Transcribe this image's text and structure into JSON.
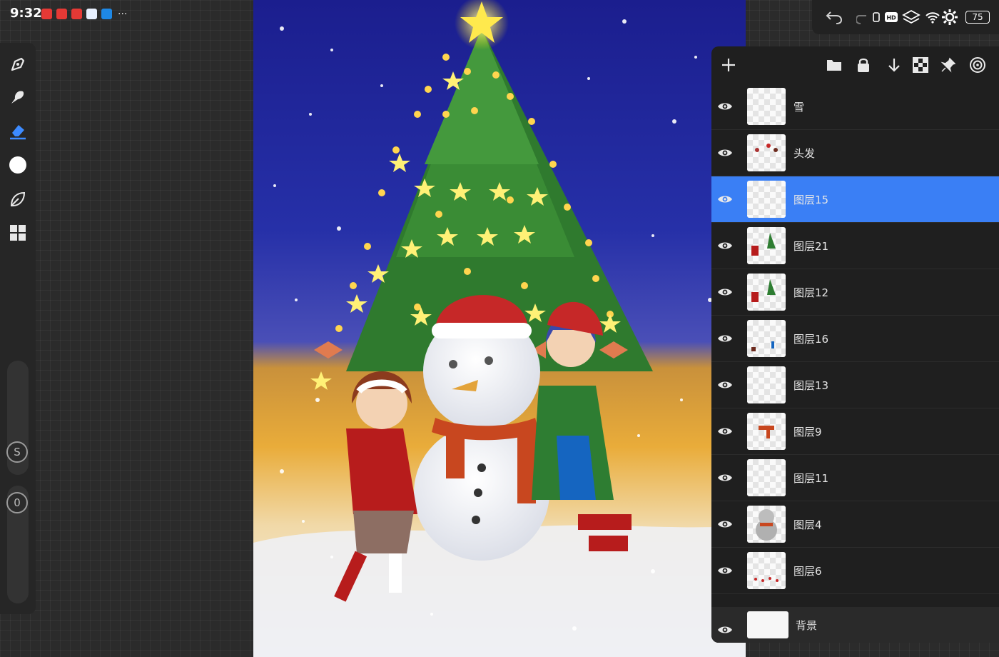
{
  "status_bar": {
    "time": "9:32",
    "more": "···"
  },
  "app_icons": [
    {
      "name": "app-red-1",
      "color": "#e53935"
    },
    {
      "name": "app-red-2",
      "color": "#e53935"
    },
    {
      "name": "app-red-3",
      "color": "#e53935"
    },
    {
      "name": "app-white",
      "color": "#e8f0fe"
    },
    {
      "name": "app-blue",
      "color": "#1e88e5"
    }
  ],
  "system_status": {
    "battery": "75"
  },
  "left_toolbar": {
    "tools": [
      "brush-icon",
      "smudge-icon",
      "eraser-icon",
      "color-icon",
      "leaf-icon",
      "grid-icon"
    ],
    "active_tool": "eraser-icon",
    "size_label": "S",
    "opacity_label": "0"
  },
  "layers_panel": {
    "header_icons": [
      "plus-icon",
      "folder-icon",
      "lock-icon",
      "merge-down-icon",
      "checker-icon",
      "pin-icon",
      "target-icon"
    ],
    "layers": [
      {
        "name": "雪",
        "thumb": "blank"
      },
      {
        "name": "头发",
        "thumb": "hair"
      },
      {
        "name": "图层15",
        "thumb": "blank",
        "selected": true
      },
      {
        "name": "图层21",
        "thumb": "red-green"
      },
      {
        "name": "图层12",
        "thumb": "red-green"
      },
      {
        "name": "图层16",
        "thumb": "small"
      },
      {
        "name": "图层13",
        "thumb": "blank"
      },
      {
        "name": "图层9",
        "thumb": "scarf"
      },
      {
        "name": "图层11",
        "thumb": "blank"
      },
      {
        "name": "图层4",
        "thumb": "snowman"
      },
      {
        "name": "图层6",
        "thumb": "red-dots"
      }
    ],
    "background": {
      "name": "背景"
    }
  },
  "colors": {
    "selected_row": "#3a7ff5",
    "panel": "#1f1f1f",
    "sky_top": "#1d1f8f",
    "tree": "#2f7a2e"
  }
}
